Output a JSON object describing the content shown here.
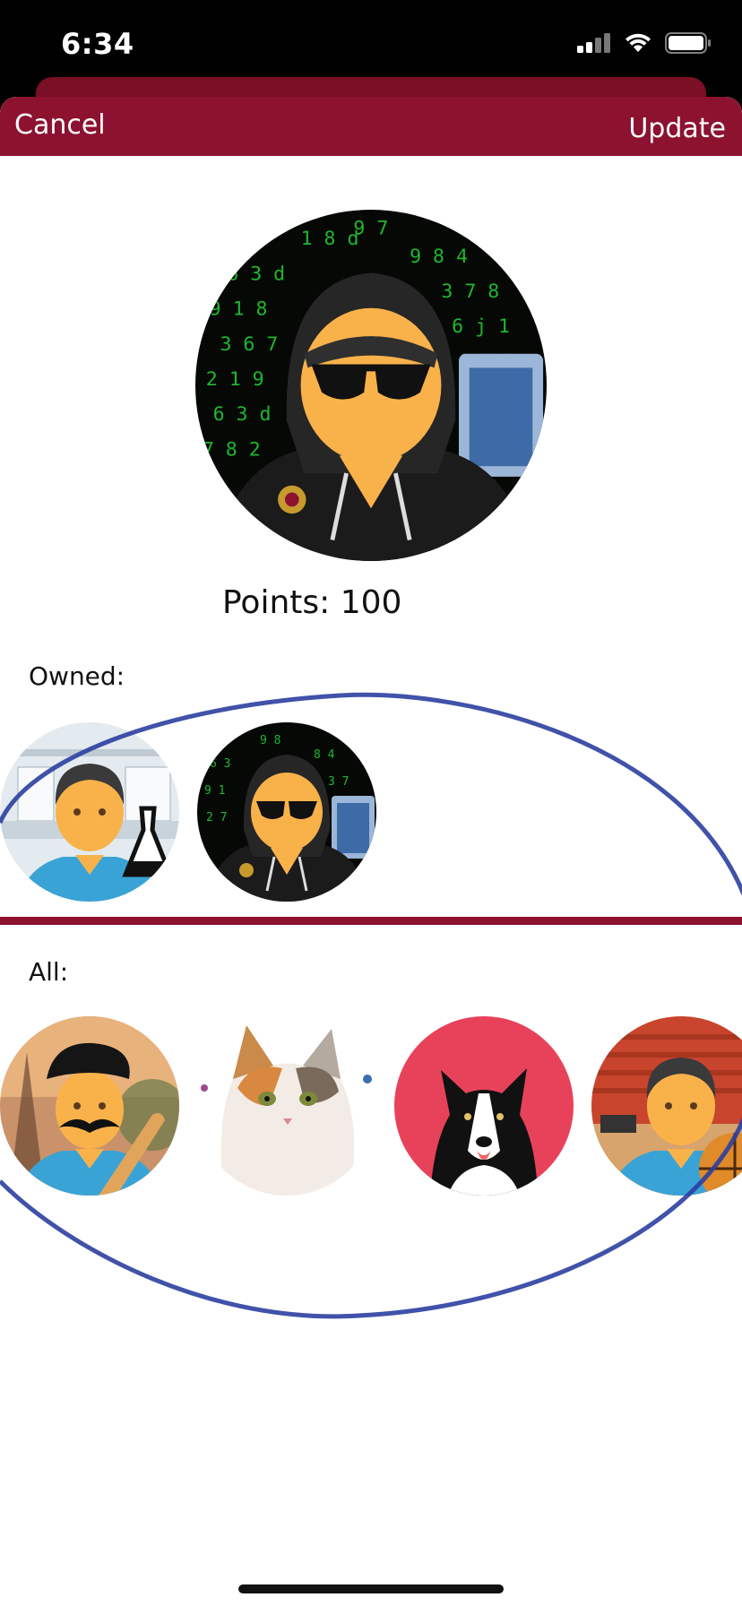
{
  "status_bar": {
    "time": "6:34"
  },
  "nav": {
    "cancel_label": "Cancel",
    "update_label": "Update"
  },
  "profile": {
    "points_text": "Points: 100"
  },
  "owned": {
    "label": "Owned:",
    "avatars": [
      {
        "name": "scientist-avatar"
      },
      {
        "name": "hacker-avatar"
      }
    ]
  },
  "all": {
    "label": "All:",
    "avatars": [
      {
        "name": "french-chef-avatar"
      },
      {
        "name": "cat-avatar"
      },
      {
        "name": "dog-avatar"
      },
      {
        "name": "basketball-avatar"
      }
    ]
  },
  "colors": {
    "brand": "#8c1230",
    "annotation": "#2b3fa0",
    "skin": "#f9b24a"
  }
}
